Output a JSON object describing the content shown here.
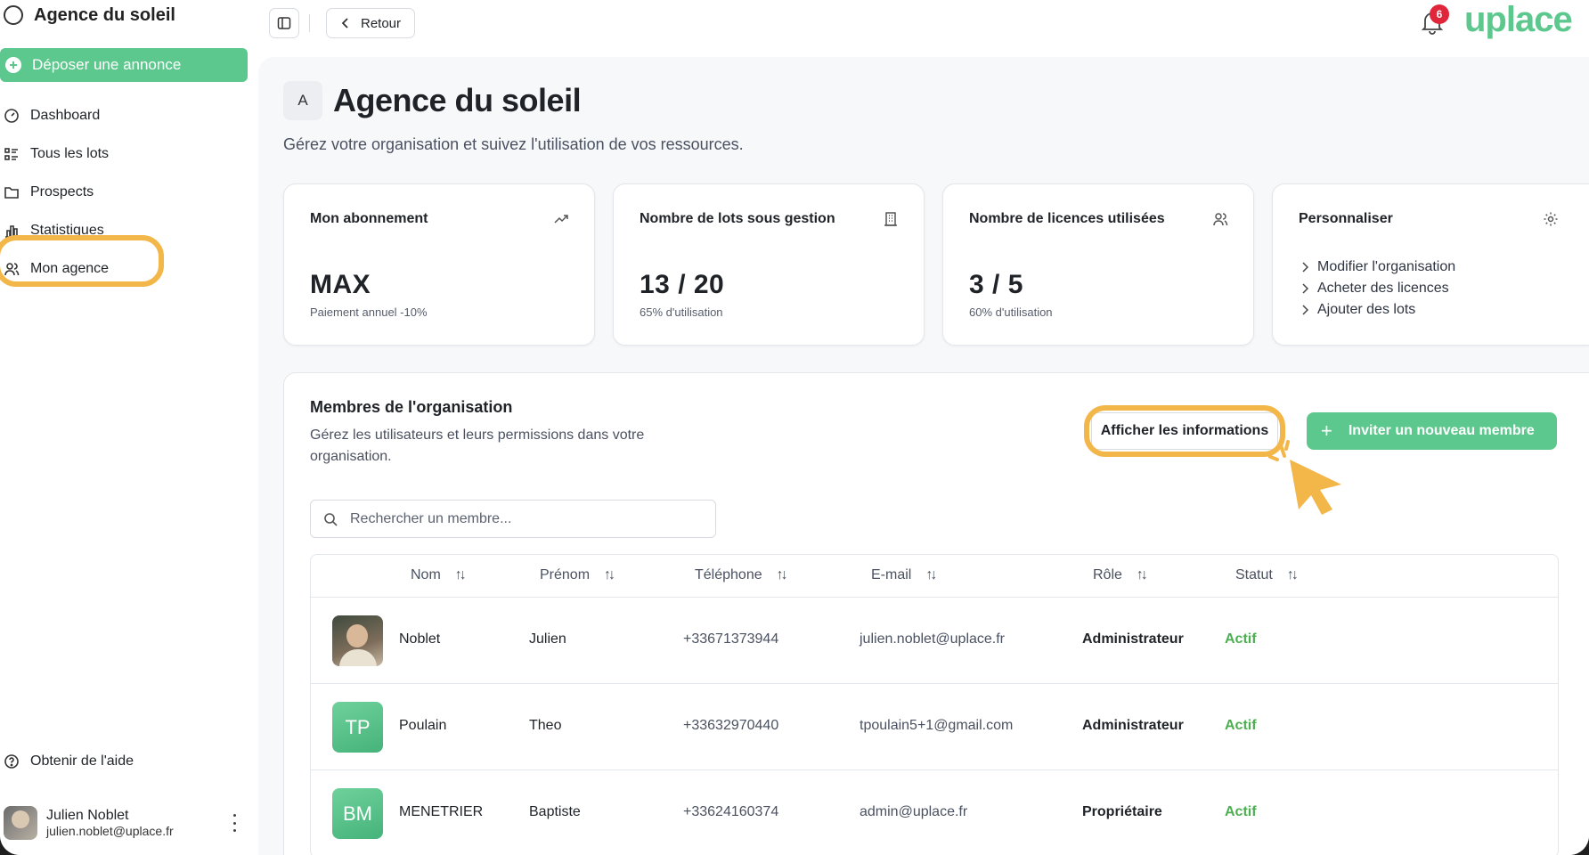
{
  "sidebar": {
    "brand": "Agence du soleil",
    "cta_label": "Déposer une annonce",
    "items": [
      {
        "label": "Dashboard",
        "icon": "gauge-icon"
      },
      {
        "label": "Tous les lots",
        "icon": "list-icon"
      },
      {
        "label": "Prospects",
        "icon": "folder-icon"
      },
      {
        "label": "Statistiques",
        "icon": "chart-icon"
      },
      {
        "label": "Mon agence",
        "icon": "users-icon"
      }
    ],
    "help_label": "Obtenir de l'aide",
    "user": {
      "name": "Julien Noblet",
      "email": "julien.noblet@uplace.fr"
    }
  },
  "topbar": {
    "back_label": "Retour",
    "notification_count": "6",
    "logo": "uplace"
  },
  "page": {
    "badge": "A",
    "title": "Agence du soleil",
    "subtitle": "Gérez votre organisation et suivez l'utilisation de vos ressources."
  },
  "cards": {
    "subscription": {
      "title": "Mon abonnement",
      "value": "MAX",
      "note": "Paiement annuel -10%",
      "icon": "trending-up-icon"
    },
    "lots": {
      "title": "Nombre de lots sous gestion",
      "value": "13 / 20",
      "note": "65% d'utilisation",
      "icon": "building-icon"
    },
    "licences": {
      "title": "Nombre de licences utilisées",
      "value": "3 / 5",
      "note": "60% d'utilisation",
      "icon": "users-icon"
    },
    "customize": {
      "title": "Personnaliser",
      "icon": "gear-icon",
      "links": [
        "Modifier l'organisation",
        "Acheter des licences",
        "Ajouter des lots"
      ]
    }
  },
  "members": {
    "title": "Membres de l'organisation",
    "description": "Gérez les utilisateurs et leurs permissions dans votre organisation.",
    "info_button": "Afficher les informations",
    "invite_button": "Inviter un nouveau membre",
    "search_placeholder": "Rechercher un membre...",
    "columns": [
      "Nom",
      "Prénom",
      "Téléphone",
      "E-mail",
      "Rôle",
      "Statut"
    ],
    "rows": [
      {
        "avatar": "",
        "nom": "Noblet",
        "prenom": "Julien",
        "telephone": "+33671373944",
        "email": "julien.noblet@uplace.fr",
        "role": "Administrateur",
        "statut": "Actif"
      },
      {
        "avatar": "TP",
        "nom": "Poulain",
        "prenom": "Theo",
        "telephone": "+33632970440",
        "email": "tpoulain5+1@gmail.com",
        "role": "Administrateur",
        "statut": "Actif"
      },
      {
        "avatar": "BM",
        "nom": "MENETRIER",
        "prenom": "Baptiste",
        "telephone": "+33624160374",
        "email": "admin@uplace.fr",
        "role": "Propriétaire",
        "statut": "Actif"
      }
    ]
  },
  "colors": {
    "accent": "#5cc88d",
    "highlight": "#f2b649",
    "status_active": "#4caf50",
    "badge": "#e0263a"
  }
}
